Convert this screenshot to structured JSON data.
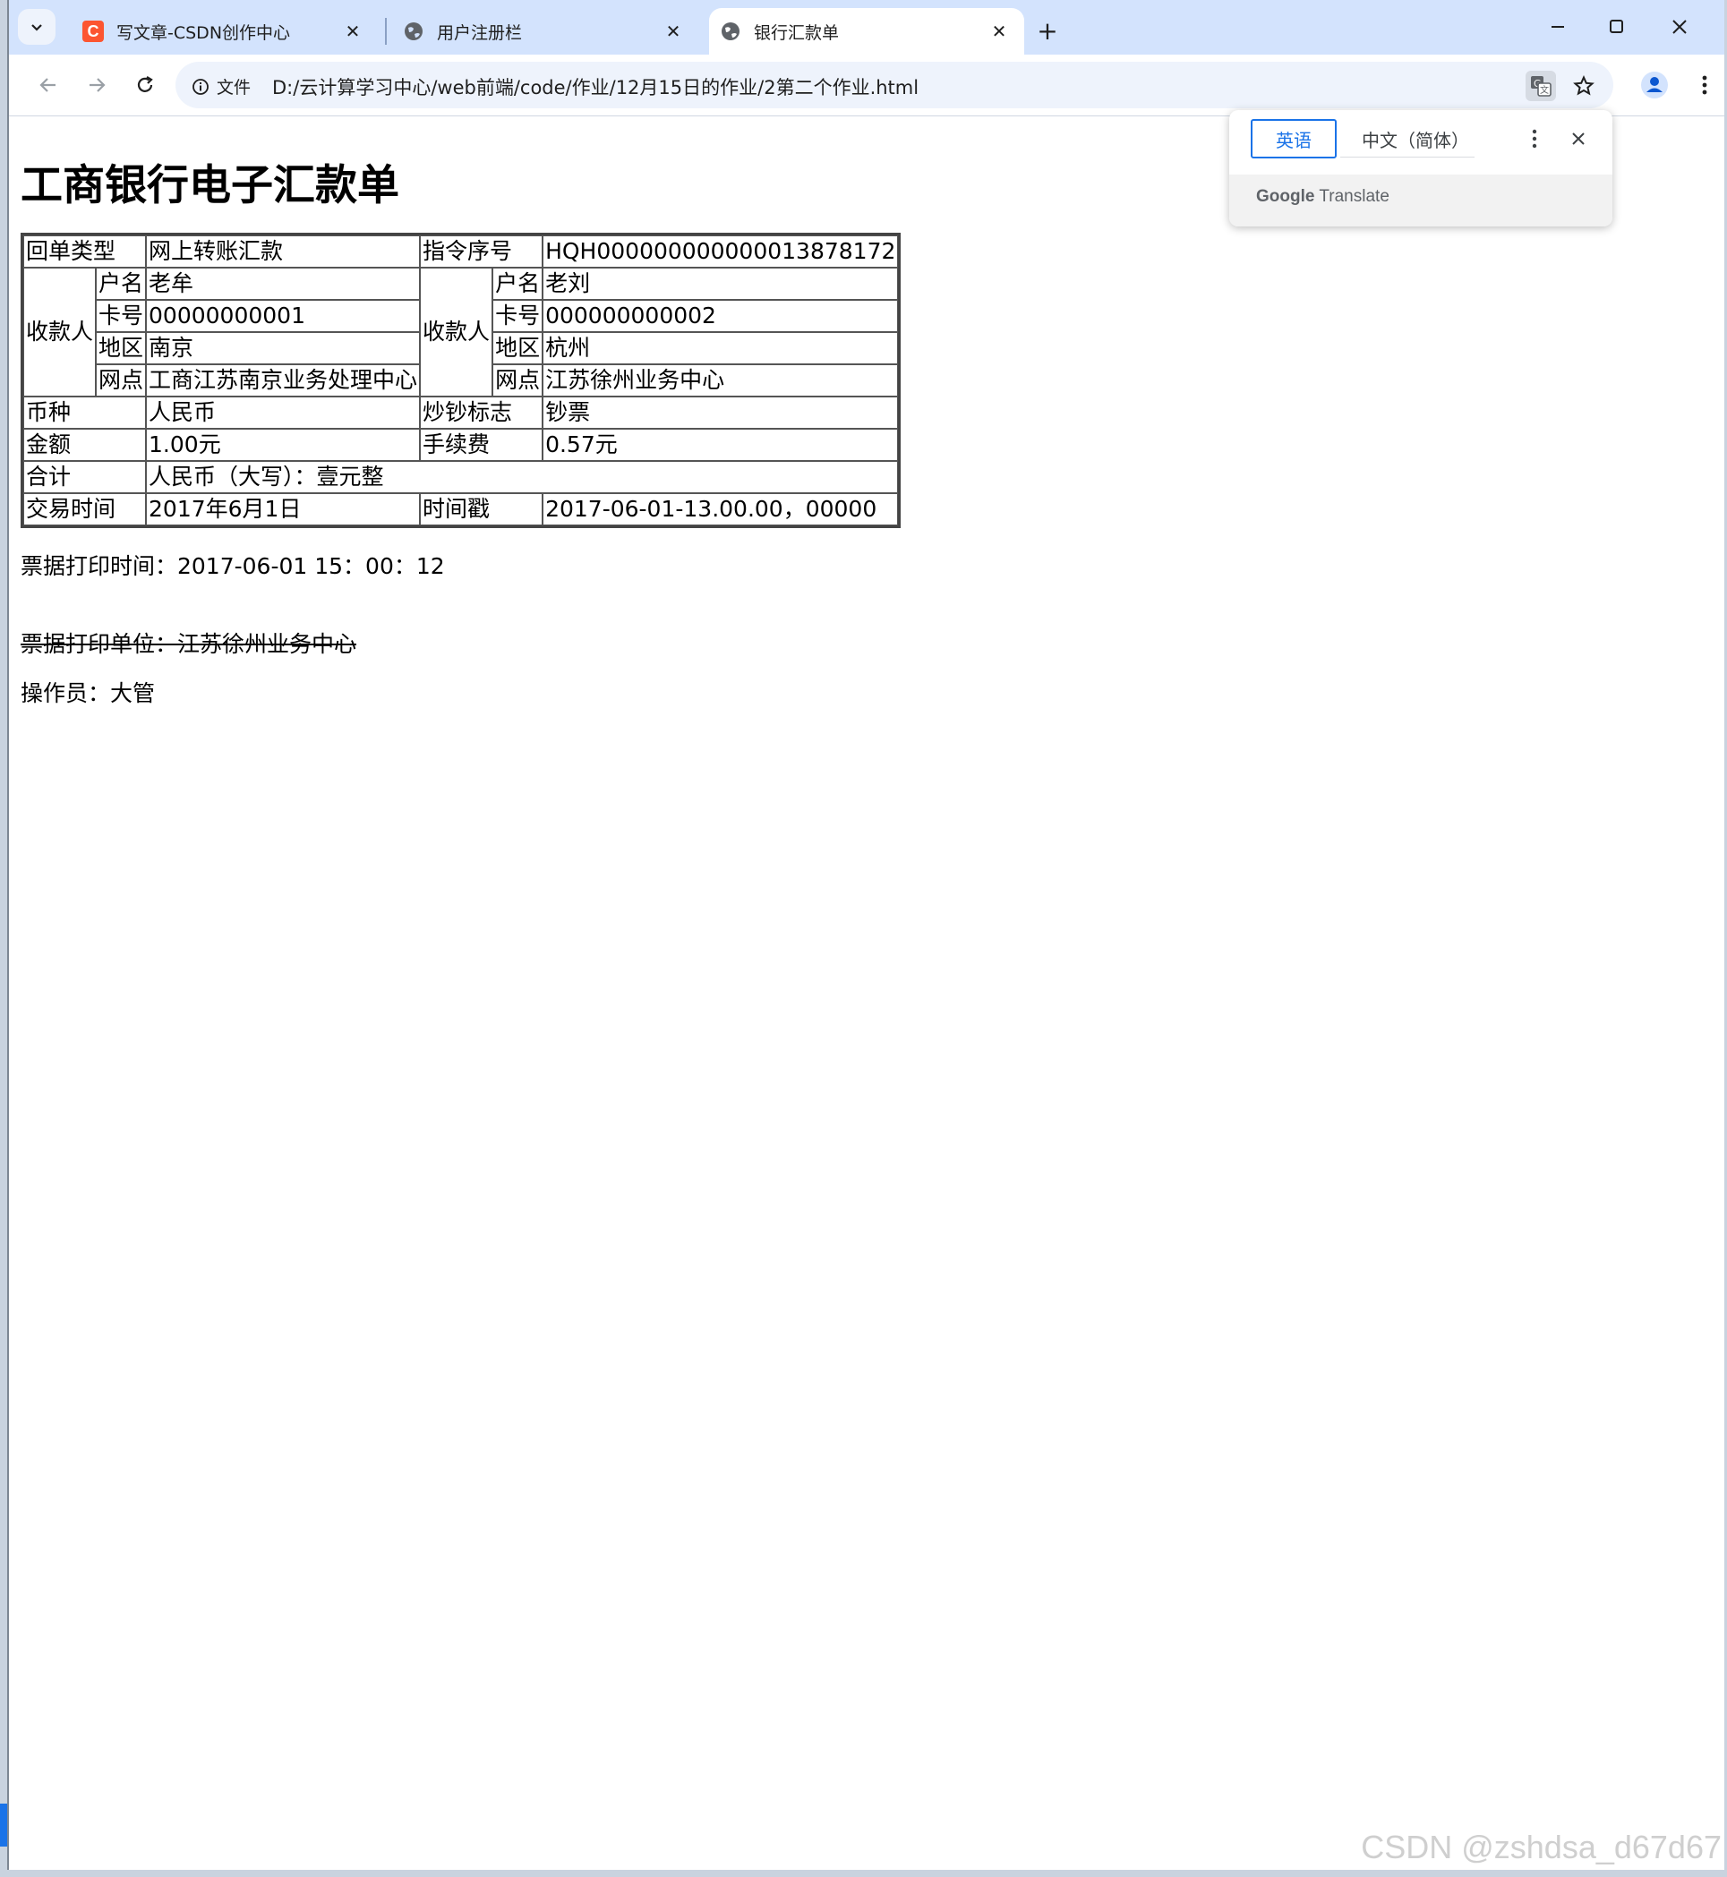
{
  "browser": {
    "tabs": [
      {
        "title": "写文章-CSDN创作中心"
      },
      {
        "title": "用户注册栏"
      },
      {
        "title": "银行汇款单"
      }
    ],
    "address": {
      "scheme_label": "文件",
      "url": "D:/云计算学习中心/web前端/code/作业/12月15日的作业/2第二个作业.html"
    },
    "tab_icon_letter": "C"
  },
  "translate_popup": {
    "source_lang": "英语",
    "target_lang": "中文（简体）",
    "brand": "Google",
    "product": "Translate"
  },
  "page": {
    "title": "工商银行电子汇款单",
    "table": {
      "r1": {
        "c1": "回单类型",
        "c2": "网上转账汇款",
        "c3": "指令序号",
        "c4": "HQH000000000000013878172"
      },
      "payer_group": "收款人",
      "payee_group": "收款人",
      "name": {
        "label_l": "户名",
        "value_l": "老牟",
        "label_r": "户名",
        "value_r": "老刘"
      },
      "card": {
        "label_l": "卡号",
        "value_l": "00000000001",
        "label_r": "卡号",
        "value_r": "000000000002"
      },
      "area": {
        "label_l": "地区",
        "value_l": "南京",
        "label_r": "地区",
        "value_r": "杭州"
      },
      "branch": {
        "label_l": "网点",
        "value_l": "工商江苏南京业务处理中心",
        "label_r": "网点",
        "value_r": "江苏徐州业务中心"
      },
      "currency": {
        "c1": "币种",
        "c2": "人民币",
        "c3": "炒钞标志",
        "c4": "钞票"
      },
      "amount": {
        "c1": "金额",
        "c2": "1.00元",
        "c3": "手续费",
        "c4": "0.57元"
      },
      "total": {
        "c1": "合计",
        "c2": "人民币（大写）：壹元整"
      },
      "time": {
        "c1": "交易时间",
        "c2": "2017年6月1日",
        "c3": "时间戳",
        "c4": "2017-06-01-13.00.00，00000"
      }
    },
    "print_time": "票据打印时间：2017-06-01 15：00：12",
    "print_unit": "票据打印单位：江苏徐州业务中心",
    "operator": "操作员：大管"
  },
  "watermark": "CSDN @zshdsa_d67d67"
}
